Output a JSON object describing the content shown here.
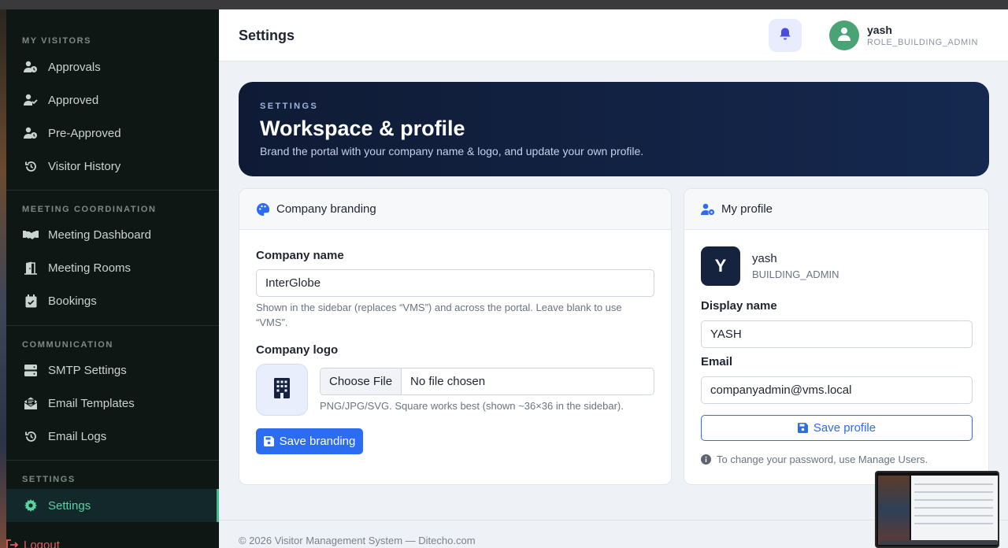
{
  "header": {
    "title": "Settings",
    "user_name": "yash",
    "user_role": "ROLE_BUILDING_ADMIN"
  },
  "sidebar": {
    "sections": [
      {
        "title": "MY VISITORS",
        "items": [
          {
            "label": "Approvals",
            "icon": "user-clock-icon"
          },
          {
            "label": "Approved",
            "icon": "user-check-icon"
          },
          {
            "label": "Pre-Approved",
            "icon": "user-clock-icon"
          },
          {
            "label": "Visitor History",
            "icon": "history-icon"
          }
        ]
      },
      {
        "title": "MEETING COORDINATION",
        "items": [
          {
            "label": "Meeting Dashboard",
            "icon": "handshake-icon"
          },
          {
            "label": "Meeting Rooms",
            "icon": "door-icon"
          },
          {
            "label": "Bookings",
            "icon": "calendar-check-icon"
          }
        ]
      },
      {
        "title": "COMMUNICATION",
        "items": [
          {
            "label": "SMTP Settings",
            "icon": "server-icon"
          },
          {
            "label": "Email Templates",
            "icon": "envelope-open-icon"
          },
          {
            "label": "Email Logs",
            "icon": "history-icon"
          }
        ]
      },
      {
        "title": "SETTINGS",
        "items": [
          {
            "label": "Settings",
            "icon": "gear-icon",
            "active": true
          }
        ]
      }
    ],
    "logout_label": "Logout"
  },
  "hero": {
    "eyebrow": "SETTINGS",
    "title": "Workspace & profile",
    "subtitle": "Brand the portal with your company name & logo, and update your own profile."
  },
  "branding": {
    "title": "Company branding",
    "company_name_label": "Company name",
    "company_name_value": "InterGlobe",
    "company_name_hint": "Shown in the sidebar (replaces “VMS”) and across the portal. Leave blank to use “VMS”.",
    "logo_label": "Company logo",
    "choose_file_label": "Choose File",
    "file_status": "No file chosen",
    "logo_hint": "PNG/JPG/SVG. Square works best (shown ~36×36 in the sidebar).",
    "save_label": "Save branding"
  },
  "profile": {
    "title": "My profile",
    "avatar_letter": "Y",
    "name": "yash",
    "role": "BUILDING_ADMIN",
    "display_name_label": "Display name",
    "display_name_value": "YASH",
    "email_label": "Email",
    "email_value": "companyadmin@vms.local",
    "save_label": "Save profile",
    "password_note": "To change your password, use Manage Users."
  },
  "footer": {
    "text": "© 2026 Visitor Management System — Ditecho.com"
  },
  "colors": {
    "sidebar_bg": "#0f1714",
    "accent_green": "#57d3a0",
    "primary_blue": "#2b6cf0",
    "hero_bg": "#0f1b35"
  }
}
